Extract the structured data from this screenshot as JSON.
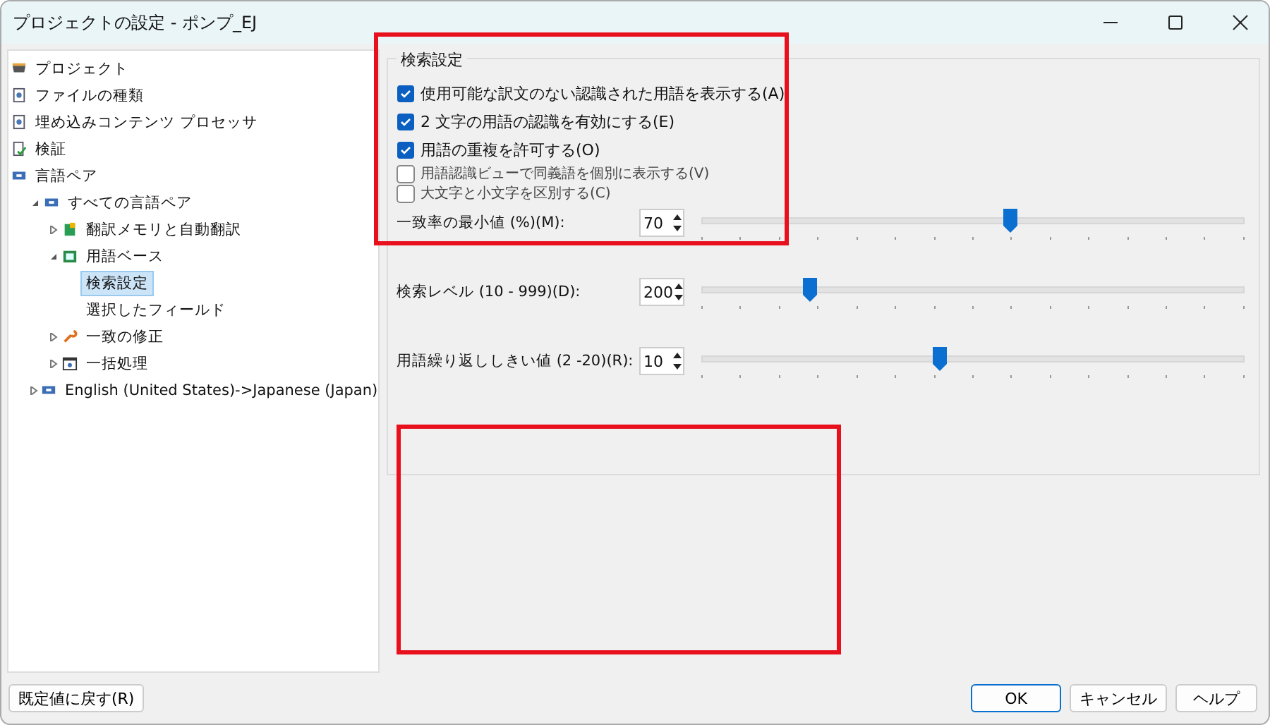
{
  "window": {
    "title": "プロジェクトの設定 - ポンプ_EJ"
  },
  "tree": [
    {
      "label": "プロジェクト",
      "kind": "project",
      "selected": false
    },
    {
      "label": "ファイルの種類",
      "kind": "page",
      "selected": false
    },
    {
      "label": "埋め込みコンテンツ プロセッサ",
      "kind": "page",
      "selected": false
    },
    {
      "label": "検証",
      "kind": "verify",
      "selected": false
    },
    {
      "label": "言語ペア",
      "kind": "pair",
      "selected": false,
      "children": [
        {
          "label": "すべての言語ペア",
          "kind": "pair",
          "selected": false,
          "expanded": true,
          "children": [
            {
              "label": "翻訳メモリと自動翻訳",
              "kind": "memory",
              "selected": false,
              "expanded": false
            },
            {
              "label": "用語ベース",
              "kind": "termbase",
              "selected": false,
              "expanded": true,
              "children": [
                {
                  "label": "検索設定",
                  "selected": true
                },
                {
                  "label": "選択したフィールド",
                  "selected": false
                }
              ]
            },
            {
              "label": "一致の修正",
              "kind": "wrench",
              "selected": false,
              "expanded": false
            },
            {
              "label": "一括処理",
              "kind": "batch",
              "selected": false,
              "expanded": false
            }
          ]
        },
        {
          "label": "English (United States)->Japanese (Japan)",
          "kind": "pair",
          "selected": false,
          "expanded": false
        }
      ]
    }
  ],
  "group": {
    "title": "検索設定",
    "checkboxes": [
      {
        "label": "使用可能な訳文のない認識された用語を表示する(A)",
        "checked": true,
        "partial": false
      },
      {
        "label": "2 文字の用語の認識を有効にする(E)",
        "checked": true,
        "partial": false
      },
      {
        "label": "用語の重複を許可する(O)",
        "checked": true,
        "partial": false
      },
      {
        "label": "用語認識ビューで同義語を個別に表示する(V)",
        "checked": false,
        "partial": true
      },
      {
        "label": "大文字と小文字を区別する(C)",
        "checked": false,
        "partial": true
      }
    ],
    "sliders": [
      {
        "label": "一致率の最小値 (%)(M):",
        "value": "70",
        "level": 0.57
      },
      {
        "label": "検索レベル (10 - 999)(D):",
        "value": "200",
        "level": 0.2
      },
      {
        "label": "用語繰り返ししきい値 (2 -20)(R):",
        "value": "10",
        "level": 0.44
      }
    ]
  },
  "buttons": {
    "reset": "既定値に戻す(R)",
    "ok": "OK",
    "cancel": "キャンセル",
    "help": "ヘルプ"
  }
}
